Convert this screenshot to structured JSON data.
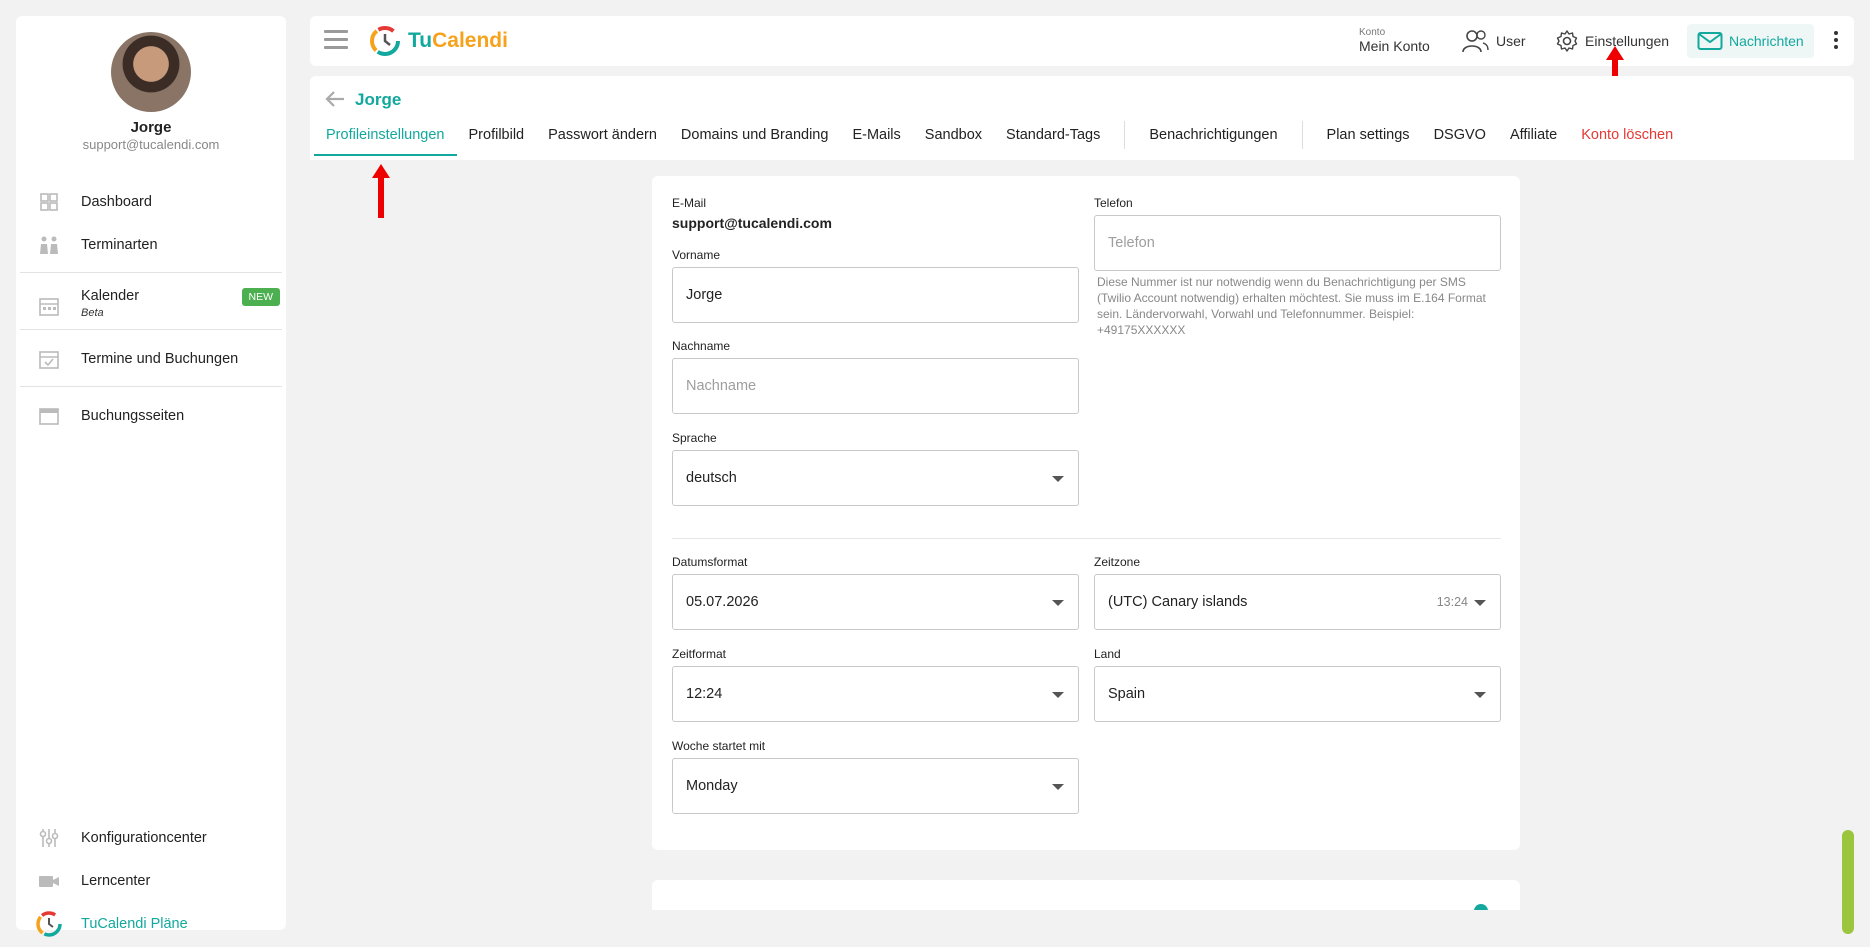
{
  "sidebar": {
    "user_name": "Jorge",
    "user_email": "support@tucalendi.com",
    "items": [
      {
        "label": "Dashboard"
      },
      {
        "label": "Terminarten"
      },
      {
        "label": "Kalender",
        "sub": "Beta",
        "badge": "NEW"
      },
      {
        "label": "Termine und Buchungen"
      },
      {
        "label": "Buchungsseiten"
      }
    ],
    "bottom_items": [
      {
        "label": "Konfigurationcenter"
      },
      {
        "label": "Lerncenter"
      },
      {
        "label": "TuCalendi Pläne"
      }
    ]
  },
  "header": {
    "logo_tu": "Tu",
    "logo_cal": "Calendi",
    "konto_small": "Konto",
    "konto_main": "Mein Konto",
    "user_label": "User",
    "settings_label": "Einstellungen",
    "messages_label": "Nachrichten"
  },
  "page": {
    "title": "Jorge",
    "tabs": [
      "Profileinstellungen",
      "Profilbild",
      "Passwort ändern",
      "Domains und Branding",
      "E-Mails",
      "Sandbox",
      "Standard-Tags",
      "Benachrichtigungen",
      "Plan settings",
      "DSGVO",
      "Affiliate",
      "Konto löschen"
    ],
    "active_tab": "Profileinstellungen"
  },
  "form": {
    "email_label": "E-Mail",
    "email_value": "support@tucalendi.com",
    "vorname_label": "Vorname",
    "vorname_value": "Jorge",
    "nachname_label": "Nachname",
    "nachname_placeholder": "Nachname",
    "sprache_label": "Sprache",
    "sprache_value": "deutsch",
    "telefon_label": "Telefon",
    "telefon_placeholder": "Telefon",
    "telefon_hint": "Diese Nummer ist nur notwendig wenn du Benachrichtigung per SMS (Twilio Account notwendig) erhalten möchtest. Sie muss im E.164 Format sein. Ländervorwahl, Vorwahl und Telefonnummer. Beispiel: +49175XXXXXX",
    "datumsformat_label": "Datumsformat",
    "datumsformat_value": "05.07.2026",
    "zeitzone_label": "Zeitzone",
    "zeitzone_value": "(UTC) Canary islands",
    "zeitzone_time": "13:24",
    "zeitformat_label": "Zeitformat",
    "zeitformat_value": "12:24",
    "land_label": "Land",
    "land_value": "Spain",
    "woche_label": "Woche startet mit",
    "woche_value": "Monday"
  },
  "colors": {
    "accent": "#13a89e",
    "logo_orange": "#f6a21c",
    "danger": "#e53935",
    "badge": "#4caf50",
    "annotation_arrow": "#e00000"
  }
}
